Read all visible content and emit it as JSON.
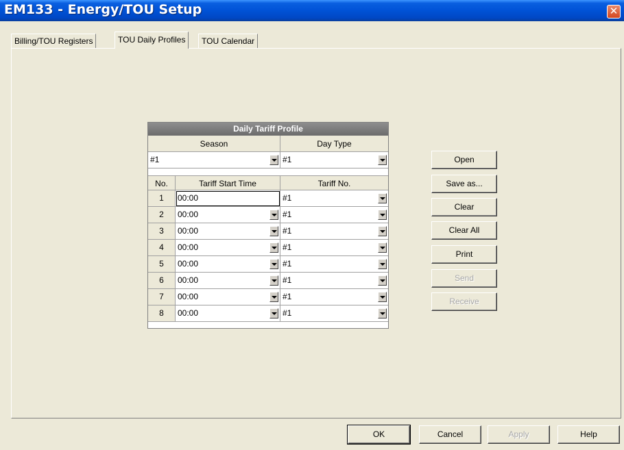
{
  "window": {
    "title": "EM133 - Energy/TOU Setup",
    "close_glyph": "✕"
  },
  "tabs": [
    {
      "label": "Billing/TOU Registers"
    },
    {
      "label": "TOU Daily Profiles"
    },
    {
      "label": "TOU Calendar"
    }
  ],
  "profile": {
    "title": "Daily Tariff Profile",
    "season_label": "Season",
    "daytype_label": "Day Type",
    "season_value": "#1",
    "daytype_value": "#1",
    "columns": [
      "No.",
      "Tariff Start Time",
      "Tariff No."
    ],
    "rows": [
      {
        "no": "1",
        "start": "00:00",
        "tariff": "#1"
      },
      {
        "no": "2",
        "start": "00:00",
        "tariff": "#1"
      },
      {
        "no": "3",
        "start": "00:00",
        "tariff": "#1"
      },
      {
        "no": "4",
        "start": "00:00",
        "tariff": "#1"
      },
      {
        "no": "5",
        "start": "00:00",
        "tariff": "#1"
      },
      {
        "no": "6",
        "start": "00:00",
        "tariff": "#1"
      },
      {
        "no": "7",
        "start": "00:00",
        "tariff": "#1"
      },
      {
        "no": "8",
        "start": "00:00",
        "tariff": "#1"
      }
    ]
  },
  "side_buttons": {
    "open": "Open",
    "save_as": "Save as...",
    "clear": "Clear",
    "clear_all": "Clear All",
    "print": "Print",
    "send": "Send",
    "receive": "Receive"
  },
  "footer_buttons": {
    "ok": "OK",
    "cancel": "Cancel",
    "apply": "Apply",
    "help": "Help"
  }
}
